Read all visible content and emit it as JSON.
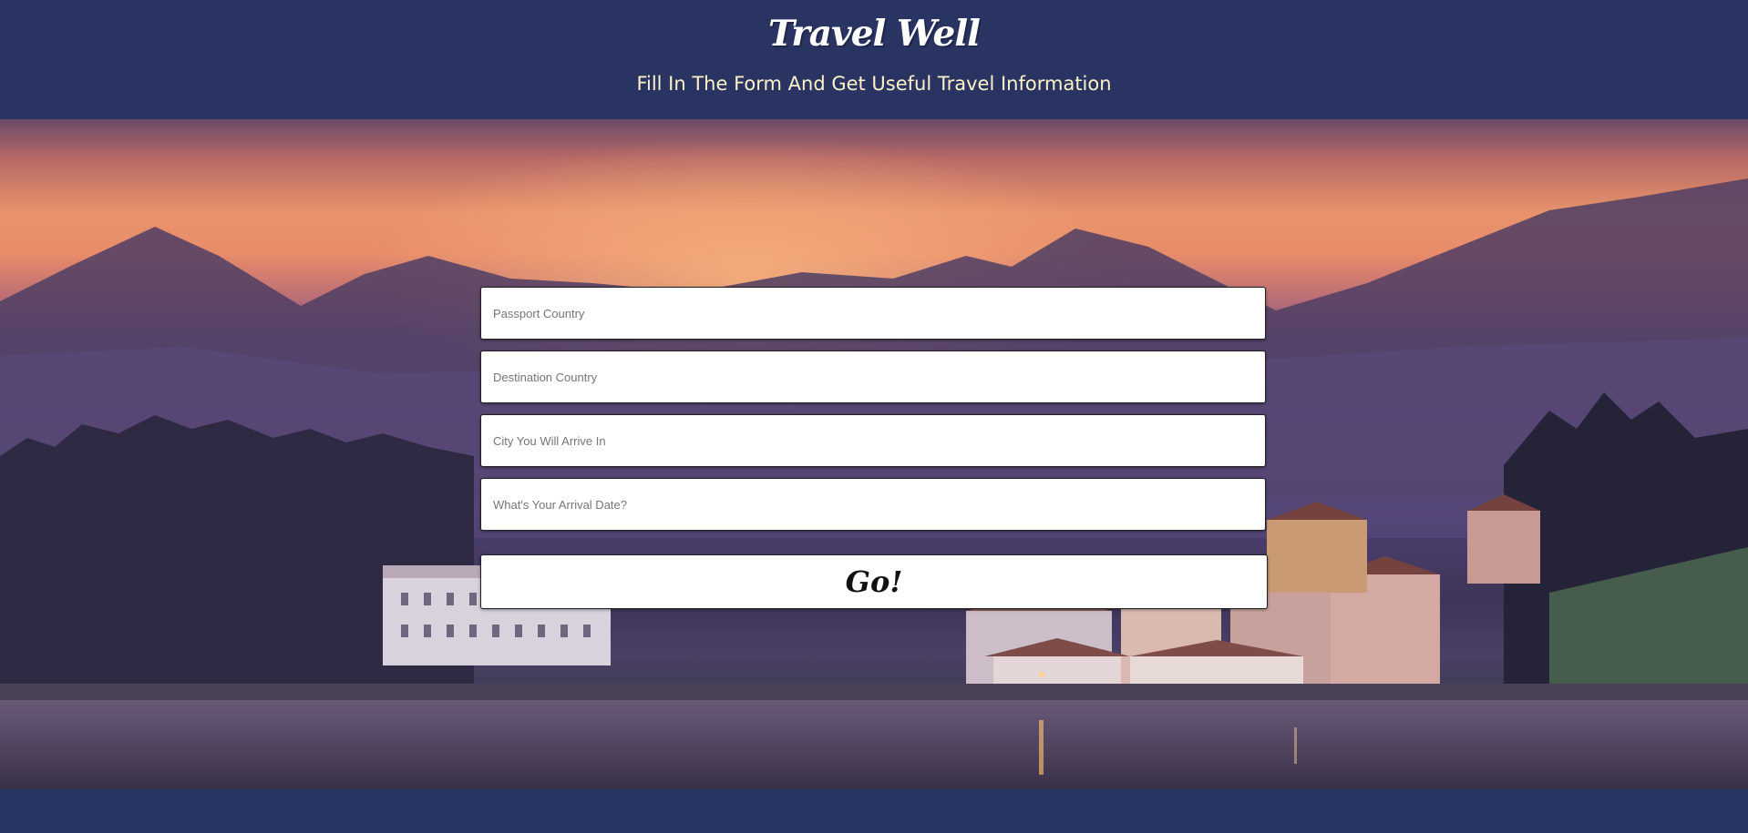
{
  "header": {
    "brand": "Travel Well",
    "tagline": "Fill In The Form And Get Useful Travel Information"
  },
  "form": {
    "passport_placeholder": "Passport Country",
    "destination_placeholder": "Destination Country",
    "city_placeholder": "City You Will Arrive In",
    "date_placeholder": "What's Your Arrival Date?",
    "submit_label": "Go!"
  },
  "colors": {
    "header_bg": "#2a3463",
    "tagline": "#fff2c6",
    "field_bg": "#ffffff"
  }
}
